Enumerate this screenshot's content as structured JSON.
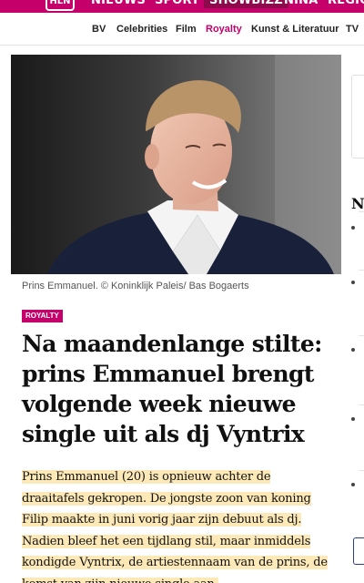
{
  "brand": {
    "logo_text": "HLN",
    "accent": "#c5006b",
    "active_tab_bg": "#8d0a4c"
  },
  "topnav": {
    "items": [
      {
        "label": "NIEUWS"
      },
      {
        "label": "SPORT"
      },
      {
        "label": "SHOWBIZZ"
      },
      {
        "label": "NINA"
      },
      {
        "label": "REGIO"
      }
    ],
    "active": "SHOWBIZZ"
  },
  "subnav": {
    "items": [
      {
        "label": "BV"
      },
      {
        "label": "Celebrities"
      },
      {
        "label": "Film"
      },
      {
        "label": "Royalty"
      },
      {
        "label": "Kunst & Literatuur"
      },
      {
        "label": "TV"
      }
    ],
    "active": "Royalty"
  },
  "article": {
    "image_caption": "Prins Emmanuel. © Koninklijk Paleis/ Bas Bogaerts",
    "category": "ROYALTY",
    "headline": "Na maandenlange stilte: prins Emmanuel brengt volgende week nieuwe single uit als dj Vyntrix",
    "lead": "Prins Emmanuel (20) is opnieuw achter de draaitafels gekropen. De jongste zoon van koning Filip maakte in juni vorig jaar zijn debuut als dj. Nadien bleef het een tijdlang stil, maar inmiddels kondigde Vyntrix, de artiestennaam van de prins, de komst van zijn nieuwe single aan."
  },
  "sidebar": {
    "title": "No"
  }
}
